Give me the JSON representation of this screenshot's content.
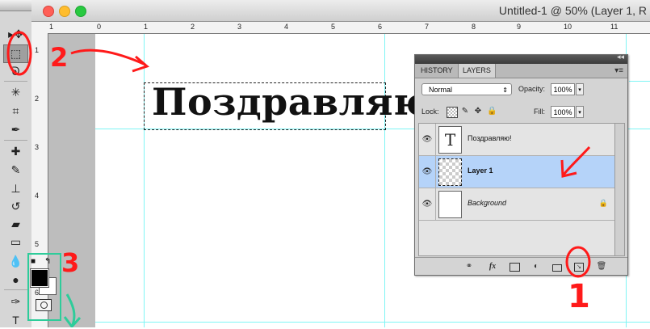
{
  "window": {
    "title": "Untitled-1 @ 50% (Layer 1, R",
    "traffic_lights": {
      "close": "#ff5f57",
      "minimize": "#ffbd2e",
      "zoom": "#28c940"
    }
  },
  "rulers": {
    "top": [
      "1",
      "0",
      "1",
      "2",
      "3",
      "4",
      "5",
      "6",
      "7",
      "8",
      "9",
      "10",
      "11"
    ],
    "left": [
      "1",
      "2",
      "3",
      "4",
      "5",
      "6"
    ]
  },
  "canvas": {
    "text": "Поздравляю!"
  },
  "tools": [
    {
      "icon": "move-icon",
      "glyph": "▸✥"
    },
    {
      "icon": "rectangular-marquee-icon",
      "glyph": "⬚"
    },
    {
      "icon": "lasso-icon",
      "glyph": "ᘐ"
    },
    {
      "icon": "magic-wand-icon",
      "glyph": "✳"
    },
    {
      "icon": "crop-icon",
      "glyph": "⌗"
    },
    {
      "icon": "eyedropper-icon",
      "glyph": "✒"
    },
    {
      "icon": "healing-brush-icon",
      "glyph": "✚"
    },
    {
      "icon": "brush-icon",
      "glyph": "✎"
    },
    {
      "icon": "clone-stamp-icon",
      "glyph": "⊥"
    },
    {
      "icon": "history-brush-icon",
      "glyph": "↺"
    },
    {
      "icon": "eraser-icon",
      "glyph": "▰"
    },
    {
      "icon": "gradient-icon",
      "glyph": "▭"
    },
    {
      "icon": "blur-icon",
      "glyph": "💧"
    },
    {
      "icon": "dodge-icon",
      "glyph": "●"
    },
    {
      "icon": "pen-icon",
      "glyph": "✑"
    },
    {
      "icon": "type-icon",
      "glyph": "T"
    }
  ],
  "panel": {
    "tabs": [
      "HISTORY",
      "LAYERS"
    ],
    "active_tab": "LAYERS",
    "blend_mode": "Normal",
    "opacity_label": "Opacity:",
    "opacity_value": "100%",
    "lock_label": "Lock:",
    "fill_label": "Fill:",
    "fill_value": "100%",
    "layers": [
      {
        "name": "Поздравляю!",
        "kind": "text",
        "selected": false
      },
      {
        "name": "Layer 1",
        "kind": "transparent",
        "selected": true
      },
      {
        "name": "Background",
        "kind": "background",
        "selected": false
      }
    ],
    "bottom_icons": [
      "link-icon",
      "fx-icon",
      "mask-icon",
      "adjustment-icon",
      "folder-icon",
      "new-layer-icon",
      "trash-icon"
    ],
    "fx_label": "fx"
  },
  "annotations": {
    "one": "1",
    "two": "2",
    "three": "3",
    "red": "#ff1a1a",
    "green": "#2ecc9a"
  }
}
